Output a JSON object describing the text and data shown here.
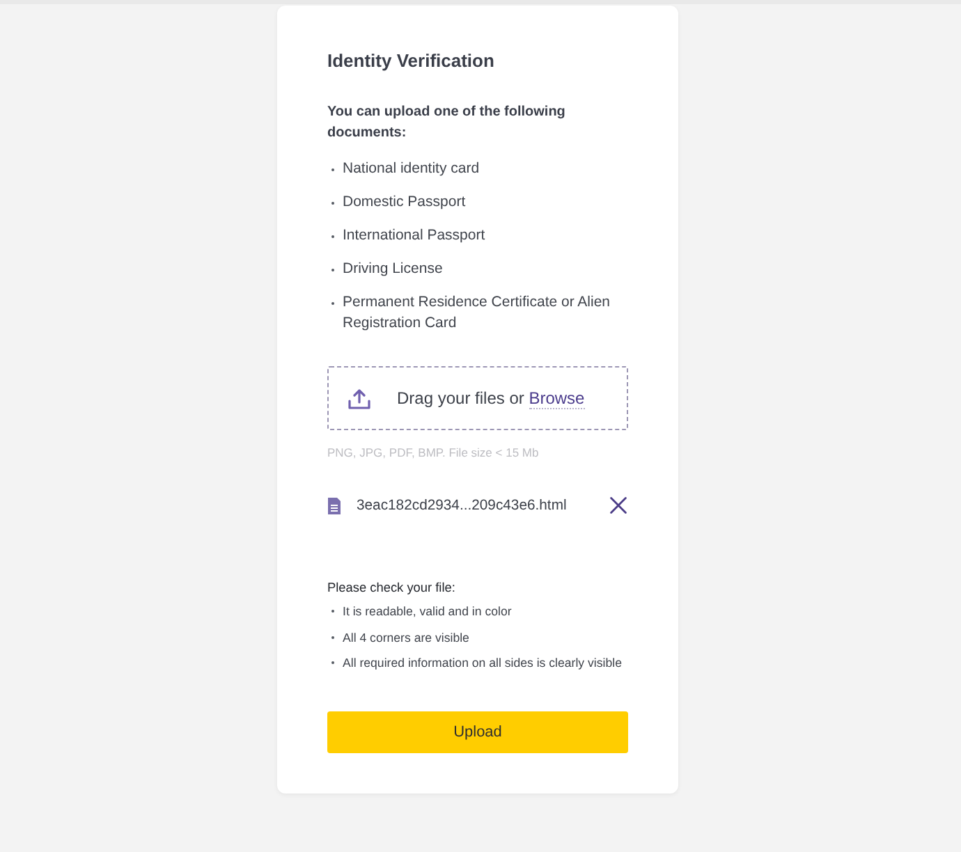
{
  "card": {
    "title": "Identity Verification",
    "intro": "You can upload one of the following documents:",
    "documents": [
      "National identity card",
      "Domestic Passport",
      "International Passport",
      "Driving License",
      "Permanent Residence Certificate or Alien Registration Card"
    ]
  },
  "dropzone": {
    "text": "Drag your files or",
    "link": "Browse",
    "hint": "PNG, JPG, PDF, BMP. File size < 15 Mb"
  },
  "files": [
    {
      "name": "3eac182cd2934...209c43e6.html"
    }
  ],
  "checklist": {
    "title": "Please check your file:",
    "items": [
      "It is readable, valid and in color",
      "All 4 corners are visible",
      "All required information on all sides is clearly visible"
    ]
  },
  "upload_button": {
    "label": "Upload"
  }
}
